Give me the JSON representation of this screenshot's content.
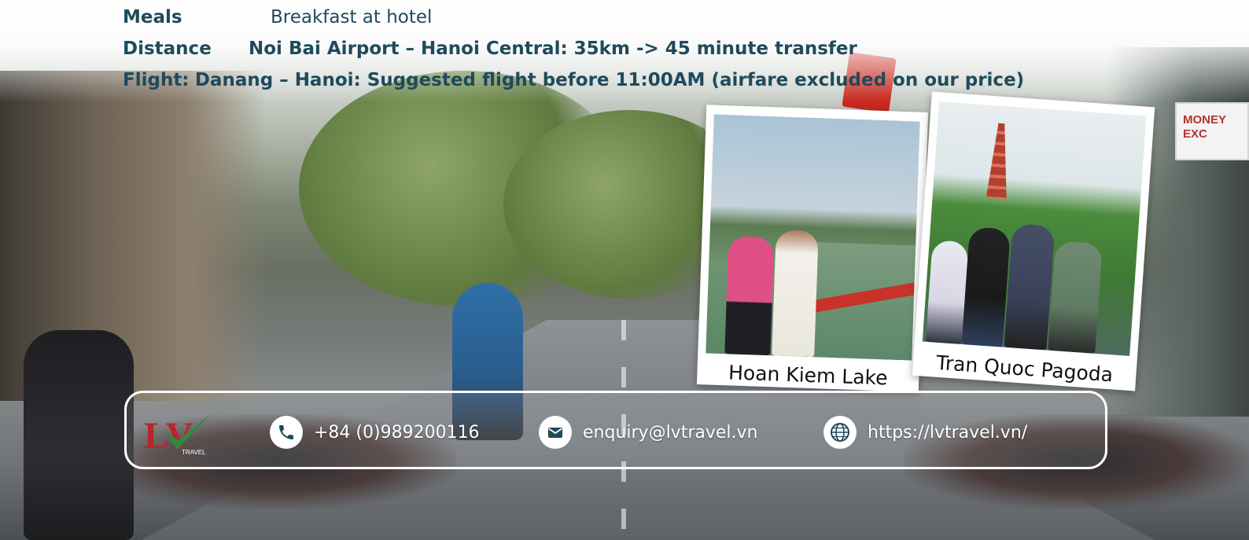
{
  "info": {
    "meals": {
      "label": "Meals",
      "value": "Breakfast at hotel"
    },
    "distance": {
      "label": "Distance",
      "value": "Noi Bai Airport – Hanoi Central: 35km -> 45 minute transfer"
    },
    "flight": {
      "label": "Flight:",
      "value": "Danang – Hanoi: Suggested flight before 11:00AM  (airfare excluded on our price)"
    }
  },
  "photos": [
    {
      "caption": "Hoan Kiem Lake"
    },
    {
      "caption": "Tran Quoc Pagoda"
    }
  ],
  "background": {
    "sign_text": "MONEY EXC"
  },
  "contact": {
    "logo_text": "LV",
    "logo_subtext": "TRAVEL",
    "phone": "+84 (0)989200116",
    "email": "enquiry@lvtravel.vn",
    "website": "https://lvtravel.vn/",
    "icons": {
      "phone": "phone-icon",
      "email": "envelope-icon",
      "website": "globe-icon"
    }
  },
  "colors": {
    "heading_text": "#1f4a5c",
    "contact_text": "#ffffff",
    "logo_red": "#b8262b",
    "logo_green": "#2e8b3e"
  }
}
